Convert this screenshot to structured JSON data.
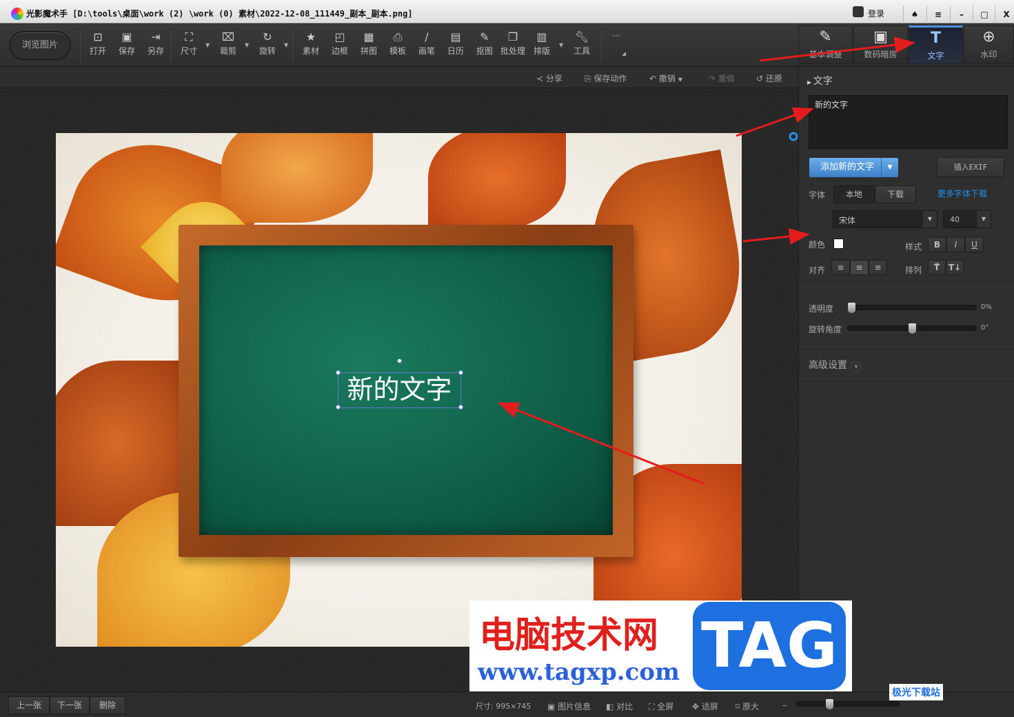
{
  "window": {
    "title": "光影魔术手  [D:\\tools\\桌面\\work (2) \\work (0) 素材\\2022-12-08_111449_副本_副本.png]",
    "login": "登录",
    "controls": [
      "skin-icon",
      "menu-icon",
      "minimize-icon",
      "maximize-icon",
      "close-icon"
    ]
  },
  "toolbar": {
    "browse": "浏览图片",
    "tools": [
      {
        "label": "打开",
        "icon": "open-icon"
      },
      {
        "label": "保存",
        "icon": "save-icon"
      },
      {
        "label": "另存",
        "icon": "save-as-icon"
      },
      {
        "label": "尺寸",
        "icon": "resize-icon"
      },
      {
        "label": "裁剪",
        "icon": "crop-icon"
      },
      {
        "label": "旋转",
        "icon": "rotate-icon"
      },
      {
        "label": "素材",
        "icon": "material-icon"
      },
      {
        "label": "边框",
        "icon": "border-icon"
      },
      {
        "label": "拼图",
        "icon": "collage-icon"
      },
      {
        "label": "模板",
        "icon": "template-icon"
      },
      {
        "label": "画笔",
        "icon": "brush-icon"
      },
      {
        "label": "日历",
        "icon": "calendar-icon"
      },
      {
        "label": "抠图",
        "icon": "cutout-icon"
      },
      {
        "label": "批处理",
        "icon": "batch-icon"
      },
      {
        "label": "排版",
        "icon": "layout-icon"
      },
      {
        "label": "工具",
        "icon": "wrench-icon"
      }
    ],
    "more": "···"
  },
  "right_tabs": [
    {
      "label": "基本调整"
    },
    {
      "label": "数码暗房"
    },
    {
      "label": "文字",
      "active": true
    },
    {
      "label": "水印"
    }
  ],
  "subbar": {
    "share": "分享",
    "save_action": "保存动作",
    "undo": "撤销",
    "redo": "重做",
    "restore": "还原"
  },
  "canvas": {
    "text_overlay": "新的文字"
  },
  "panel": {
    "section": "文字",
    "text_value": "新的文字",
    "add_text": "添加新的文字",
    "insert_exif": "插入EXIF",
    "font_label": "字体",
    "local": "本地",
    "download": "下载",
    "more_fonts": "更多字体下载",
    "font": "宋体",
    "size": "40",
    "color_label": "颜色",
    "color": "#ffffff",
    "style_label": "样式",
    "bold": "B",
    "italic": "I",
    "underline": "U",
    "align_label": "对齐",
    "arrange_label": "排列",
    "opacity_label": "透明度",
    "opacity": "0%",
    "opacity_value": 0,
    "rotate_label": "旋转角度",
    "rotate": "0°",
    "rotate_value": 0,
    "advanced": "高级设置"
  },
  "status": {
    "prev": "上一张",
    "next": "下一张",
    "delete": "删除",
    "size": "尺寸: 995×745",
    "info": "图片信息",
    "compare": "对比",
    "fullscreen": "全屏",
    "fit": "适屏",
    "original": "原大"
  },
  "watermark": {
    "site_cn": "电脑技术网",
    "tag": "TAG",
    "url": "www.tagxp.com",
    "corner": "极光下载站"
  },
  "accent": "#4a90e0",
  "annotation_color": "#e51c1c"
}
